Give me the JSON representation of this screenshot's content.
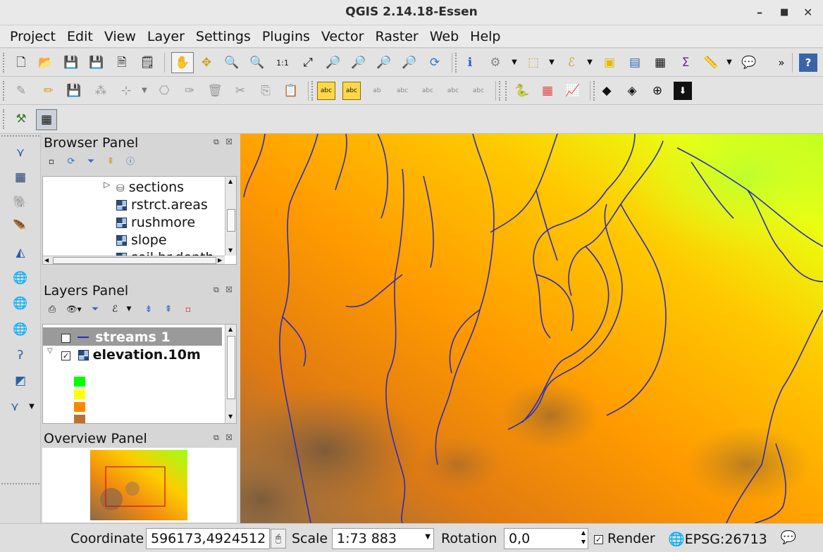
{
  "window": {
    "title": "QGIS 2.14.18-Essen"
  },
  "menu": [
    "Project",
    "Edit",
    "View",
    "Layer",
    "Settings",
    "Plugins",
    "Vector",
    "Raster",
    "Web",
    "Help"
  ],
  "browser_panel": {
    "title": "Browser Panel",
    "items": [
      "sections",
      "rstrct.areas",
      "rushmore",
      "slope",
      "soil.br.depth"
    ]
  },
  "layers_panel": {
    "title": "Layers Panel",
    "layers": [
      {
        "name": "streams 1",
        "checked": true,
        "selected": true
      },
      {
        "name": "elevation.10m",
        "checked": true,
        "expanded": true
      }
    ],
    "legend_colors": [
      "#00ff00",
      "#ffff00",
      "#ff8800",
      "#b87333"
    ]
  },
  "overview_panel": {
    "title": "Overview Panel"
  },
  "status": {
    "coordinate_label": "Coordinate",
    "coordinate_value": "596173,4924512",
    "scale_label": "Scale",
    "scale_value": "1:73 883",
    "rotation_label": "Rotation",
    "rotation_value": "0,0",
    "render_label": "Render",
    "render_checked": true,
    "crs_label": "EPSG:26713"
  },
  "colors": {
    "stream": "#2b2db8",
    "elev_low": "#7a5a3a",
    "elev_mid": "#ff8c00",
    "elev_high": "#c8ff00"
  }
}
